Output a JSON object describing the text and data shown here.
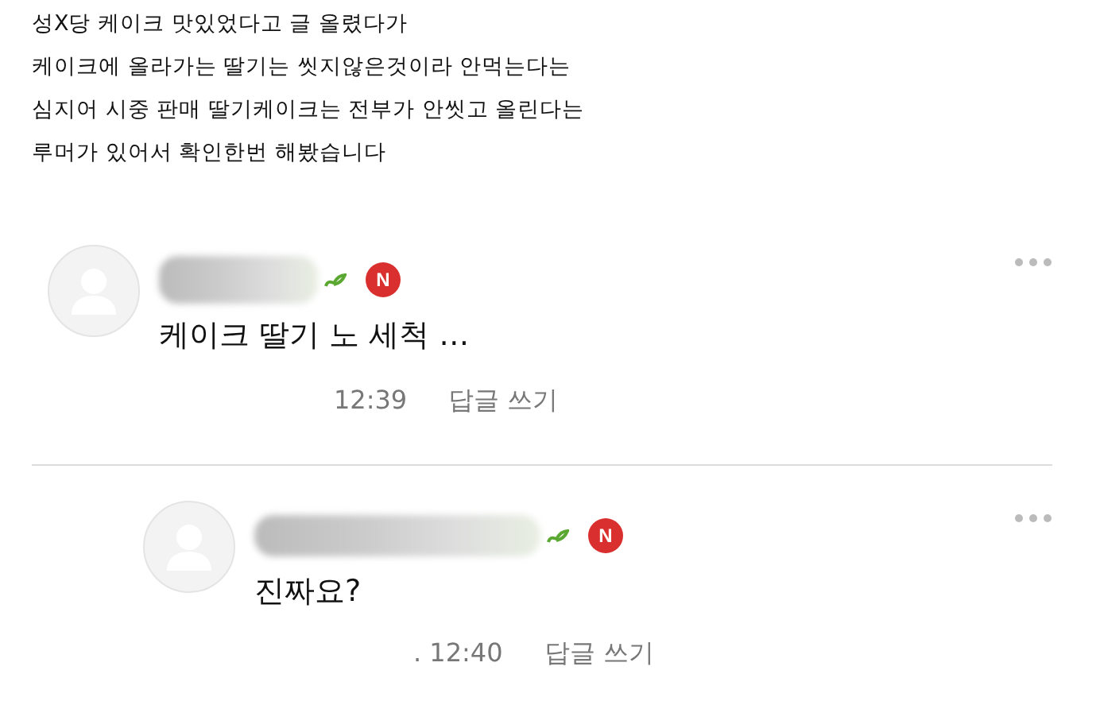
{
  "post": {
    "lines": [
      "성X당 케이크 맛있었다고 글 올렸다가",
      "케이크에 올라가는 딸기는 씻지않은것이라 안먹는다는",
      "심지어 시중 판매 딸기케이크는 전부가 안씻고 올린다는",
      "루머가 있어서 확인한번 해봤습니다"
    ]
  },
  "comments": [
    {
      "kind": "comment",
      "badge": "N",
      "text": "케이크 딸기 노 세척 …",
      "time": "12:39",
      "reply_label": "답글 쓰기"
    },
    {
      "kind": "reply",
      "badge": "N",
      "text": "진짜요?",
      "time": ". 12:40",
      "reply_label": "답글 쓰기"
    }
  ]
}
